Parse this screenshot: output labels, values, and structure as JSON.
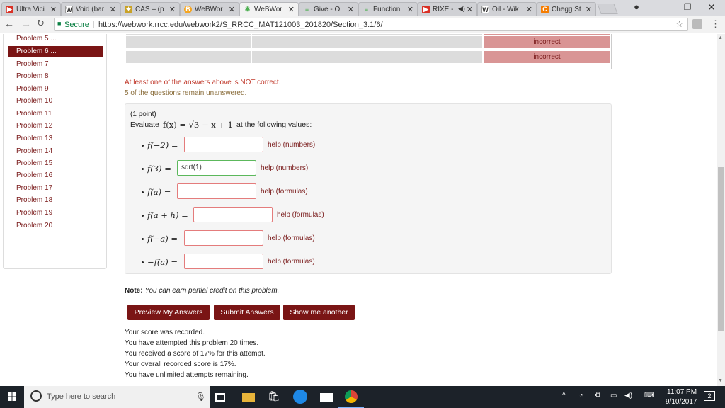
{
  "browser": {
    "tabs": [
      {
        "label": "Ultra Vici",
        "color": "#d93025",
        "glyph": "▶"
      },
      {
        "label": "Void (bar",
        "color": "#ffffff",
        "glyph": "W"
      },
      {
        "label": "CAS – (p",
        "color": "#c9a227",
        "glyph": "✦"
      },
      {
        "label": "WeBWor",
        "color": "#f5a623",
        "glyph": "B"
      },
      {
        "label": "WeBWor",
        "color": "#4caf50",
        "glyph": "✱"
      },
      {
        "label": "Give - O",
        "color": "#4caf50",
        "glyph": "≡"
      },
      {
        "label": "Function",
        "color": "#4caf50",
        "glyph": "≡"
      },
      {
        "label": "RIXE -",
        "color": "#d93025",
        "glyph": "▶"
      },
      {
        "label": "Oil - Wik",
        "color": "#ffffff",
        "glyph": "W"
      },
      {
        "label": "Chegg St",
        "color": "#f57c00",
        "glyph": "C"
      }
    ],
    "secure_label": "Secure",
    "url": "https://webwork.rrcc.edu/webwork2/S_RRCC_MAT121003_201820/Section_3.1/6/"
  },
  "sidebar": {
    "items": [
      "Problem 5 ...",
      "Problem 6 ...",
      "Problem 7",
      "Problem 8",
      "Problem 9",
      "Problem 10",
      "Problem 11",
      "Problem 12",
      "Problem 13",
      "Problem 14",
      "Problem 15",
      "Problem 16",
      "Problem 17",
      "Problem 18",
      "Problem 19",
      "Problem 20"
    ],
    "active_index": 1
  },
  "results": {
    "status_1": "incorrect",
    "status_2": "incorrect"
  },
  "messages": {
    "not_correct": "At least one of the answers above is NOT correct.",
    "unanswered": "5 of the questions remain unanswered."
  },
  "problem": {
    "points": "(1 point)",
    "prompt_prefix": "Evaluate",
    "function_math": "f(x) = √3 − x + 1",
    "prompt_suffix": "at the following values:",
    "answers": [
      {
        "label": "f(−2) =",
        "value": "",
        "help": "help (numbers)"
      },
      {
        "label": "f(3) =",
        "value": "sqrt(1)",
        "help": "help (numbers)"
      },
      {
        "label": "f(a) =",
        "value": "",
        "help": "help (formulas)"
      },
      {
        "label": "f(a + h) =",
        "value": "",
        "help": "help (formulas)"
      },
      {
        "label": "f(−a) =",
        "value": "",
        "help": "help (formulas)"
      },
      {
        "label": "−f(a) =",
        "value": "",
        "help": "help (formulas)"
      }
    ]
  },
  "note": {
    "label": "Note:",
    "text": "You can earn partial credit on this problem."
  },
  "buttons": {
    "preview": "Preview My Answers",
    "submit": "Submit Answers",
    "another": "Show me another"
  },
  "score_lines": [
    "Your score was recorded.",
    "You have attempted this problem 20 times.",
    "You received a score of 17% for this attempt.",
    "Your overall recorded score is 17%.",
    "You have unlimited attempts remaining."
  ],
  "taskbar": {
    "search_placeholder": "Type here to search",
    "time": "11:07 PM",
    "date": "9/10/2017",
    "notification_count": "2"
  },
  "colors": {
    "accent": "#7a1515",
    "incorrect_bg": "#d99595",
    "correct_border": "#5cb85c",
    "wrong_border": "#e47c7c"
  }
}
